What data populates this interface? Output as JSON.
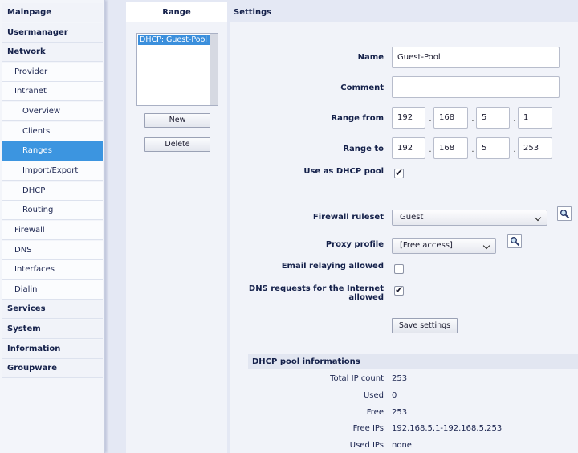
{
  "nav": {
    "items": [
      {
        "label": "Mainpage"
      },
      {
        "label": "Usermanager"
      },
      {
        "label": "Network"
      },
      {
        "label": "Provider"
      },
      {
        "label": "Intranet"
      },
      {
        "label": "Overview"
      },
      {
        "label": "Clients"
      },
      {
        "label": "Ranges"
      },
      {
        "label": "Import/Export"
      },
      {
        "label": "DHCP"
      },
      {
        "label": "Routing"
      },
      {
        "label": "Firewall"
      },
      {
        "label": "DNS"
      },
      {
        "label": "Interfaces"
      },
      {
        "label": "Dialin"
      },
      {
        "label": "Services"
      },
      {
        "label": "System"
      },
      {
        "label": "Information"
      },
      {
        "label": "Groupware"
      }
    ]
  },
  "range_panel": {
    "title": "Range",
    "list": [
      "DHCP: Guest-Pool"
    ],
    "new_label": "New",
    "delete_label": "Delete"
  },
  "settings": {
    "title": "Settings",
    "name_label": "Name",
    "name_value": "Guest-Pool",
    "comment_label": "Comment",
    "comment_value": "",
    "range_from_label": "Range from",
    "range_from": [
      "192",
      "168",
      "5",
      "1"
    ],
    "range_to_label": "Range to",
    "range_to": [
      "192",
      "168",
      "5",
      "253"
    ],
    "ip_separator": ".",
    "dhcp_pool_label": "Use as DHCP pool",
    "dhcp_pool_checked": true,
    "firewall_label": "Firewall ruleset",
    "firewall_value": "Guest",
    "proxy_label": "Proxy profile",
    "proxy_value": "[Free access]",
    "email_label": "Email relaying allowed",
    "email_checked": false,
    "dns_label_line1": "DNS requests for the Internet",
    "dns_label_line2": "allowed",
    "dns_checked": true,
    "save_label": "Save settings",
    "check_glyph": "✔"
  },
  "info": {
    "title": "DHCP pool informations",
    "rows": [
      {
        "label": "Total IP count",
        "value": "253"
      },
      {
        "label": "Used",
        "value": "0"
      },
      {
        "label": "Free",
        "value": "253"
      },
      {
        "label": "Free IPs",
        "value": "192.168.5.1-192.168.5.253"
      },
      {
        "label": "Used IPs",
        "value": "none"
      }
    ]
  },
  "colors": {
    "active_nav": "#3c95e0",
    "panel_bg": "#f1f3f9",
    "page_bg": "#e4e8f4"
  }
}
